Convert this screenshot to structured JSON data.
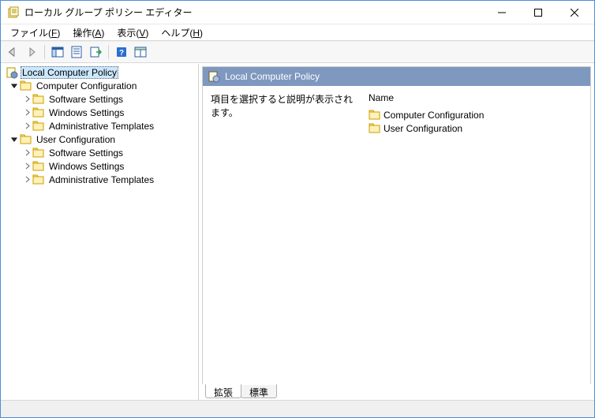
{
  "window": {
    "title": "ローカル グループ ポリシー エディター"
  },
  "menu": {
    "file": "ファイル(F)",
    "action": "操作(A)",
    "view": "表示(V)",
    "help": "ヘルプ(H)"
  },
  "tree": {
    "root": "Local Computer Policy",
    "computer": {
      "label": "Computer Configuration",
      "children": {
        "software": "Software Settings",
        "windows": "Windows Settings",
        "admin": "Administrative Templates"
      }
    },
    "user": {
      "label": "User Configuration",
      "children": {
        "software": "Software Settings",
        "windows": "Windows Settings",
        "admin": "Administrative Templates"
      }
    }
  },
  "detail": {
    "title": "Local Computer Policy",
    "description": "項目を選択すると説明が表示されます。",
    "column_name": "Name",
    "items": {
      "computer": "Computer Configuration",
      "user": "User Configuration"
    }
  },
  "tabs": {
    "extended": "拡張",
    "standard": "標準"
  }
}
